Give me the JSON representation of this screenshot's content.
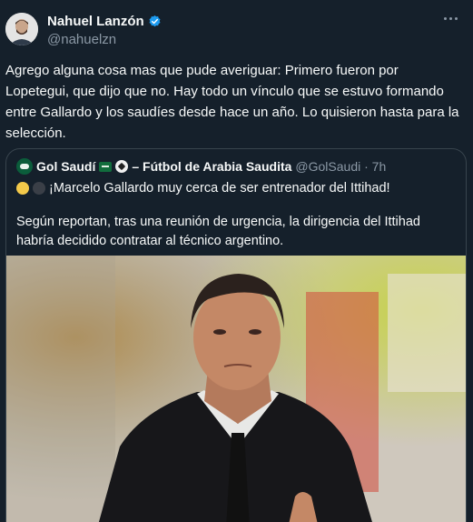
{
  "tweet": {
    "author_name": "Nahuel Lanzón",
    "author_handle": "@nahuelzn",
    "text": "Agrego alguna cosa mas que pude averiguar: Primero fueron por Lopetegui, que dijo que no. Hay todo un vínculo que se estuvo formando entre Gallardo y los saudíes desde hace un año. Lo quisieron hasta para la selección."
  },
  "quote": {
    "author_name": "Gol Saudí",
    "author_suffix": "– Fútbol de Arabia Saudita",
    "handle_time": "@GolSaudi · 7h",
    "headline": "¡Marcelo Gallardo muy cerca de ser entrenador del Ittihad!",
    "body": "Según reportan, tras una reunión de urgencia, la dirigencia del Ittihad habría decidido contratar al técnico argentino."
  },
  "icons": {
    "verified": "verified-badge-icon",
    "more": "more-options-icon",
    "flag": "saudi-flag-icon",
    "ball": "soccer-ball-icon"
  },
  "colors": {
    "background": "#15202b",
    "text": "#f7f9f9",
    "secondary": "#8b98a5",
    "verified": "#1d9bf0",
    "border": "#38444d"
  }
}
